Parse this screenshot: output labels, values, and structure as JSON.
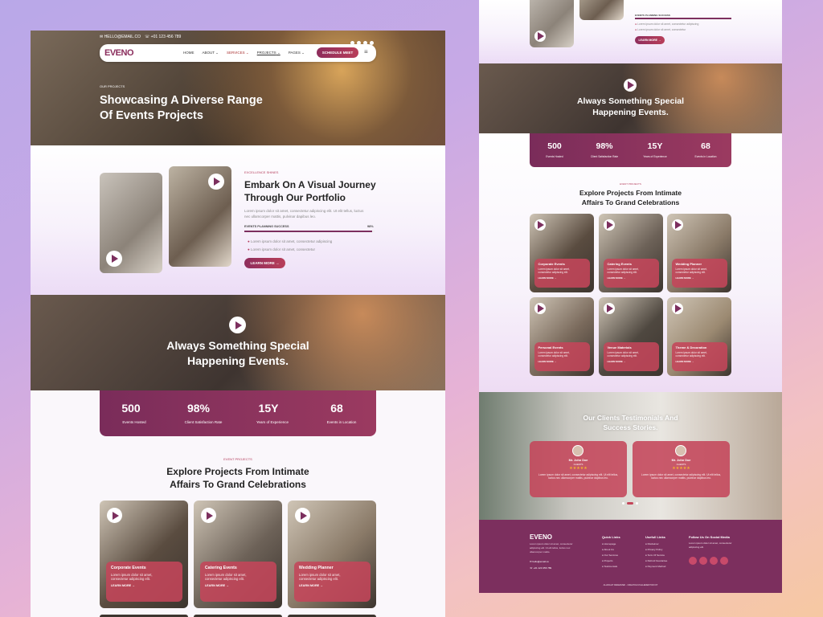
{
  "topbar": {
    "email": "HELLO@EMAIL.CO",
    "phone": "+01 123 456 789"
  },
  "nav": {
    "logo": "EVENO",
    "items": [
      "HOME",
      "ABOUT",
      "SERVICES",
      "PROJECTS",
      "PAGES"
    ],
    "cta": "SCHEDULE MEET"
  },
  "hero": {
    "eyebrow": "OUR PROJECTS",
    "title_line1": "Showcasing A Diverse Range",
    "title_line2": "Of Events Projects"
  },
  "portfolio": {
    "eyebrow": "EXCELLENCE SHINES",
    "title_line1": "Embark On A Visual Journey",
    "title_line2": "Through Our Portfolio",
    "body_line1": "Lorem ipsum dolor sit amet, consectetur adipiscing elit. Ut elit tellus, luctus",
    "body_line2": "nec ullamcorper mattis, pulvinar dapibus leo.",
    "bar_label": "EVENTS PLANNING SUCCESS",
    "bar_value": "98%",
    "bar_fraction": 0.98,
    "bullets": [
      "Lorem ipsum dolor sit amet, consectetur adipiscing",
      "Lorem ipsum dolor sit amet, consectetur"
    ],
    "button": "LEARN MORE"
  },
  "video": {
    "title_line1": "Always Something Special",
    "title_line2": "Happening Events."
  },
  "stats": [
    {
      "value": "500",
      "label": "Events Hosted"
    },
    {
      "value": "98%",
      "label": "Client Satisfaction Rate"
    },
    {
      "value": "15Y",
      "label": "Years of Experience"
    },
    {
      "value": "68",
      "label": "Events in Location"
    }
  ],
  "projects": {
    "eyebrow": "EVENT PROJECTS",
    "title_line1": "Explore Projects From Intimate",
    "title_line2": "Affairs To Grand Celebrations",
    "desc_line1": "Lorem ipsum dolor sit amet,",
    "desc_line2": "consectetur adipiscing elit.",
    "link": "LEARN MORE",
    "cards": [
      "Corporate Events",
      "Catering Events",
      "Wedding Planner",
      "Personal Events",
      "Venue Materials",
      "Theme & Decoration"
    ]
  },
  "testimonials": {
    "title_line1": "Our Clients Testimonials And",
    "title_line2": "Success Stories.",
    "items": [
      {
        "name": "Mr. John Doe",
        "role": "CLIENTS",
        "stars": "★★★★★"
      },
      {
        "name": "Mr. John Doe",
        "role": "CLIENTS",
        "stars": "★★★★★"
      }
    ],
    "quote": "Lorem ipsum dolor sit amet, consectetur adipiscing elit. Ut elit tellus, luctus nec ullamcorper mattis, pulvinar dapibus leo."
  },
  "footer": {
    "logo": "EVENO",
    "about": "Lorem ipsum dolor sit amet, consectetur adipiscing elit. Ut elit tellus, luctus nec ullamcorper mattis.",
    "email": "hello@email.co",
    "phone": "+01 123 456 789",
    "quick_title": "Quick Links",
    "quick": [
      "Homepage",
      "About Us",
      "Our Services",
      "Projects",
      "Testimonials"
    ],
    "useful_title": "Usefull Links",
    "useful": [
      "Disclaimer",
      "Privacy Policy",
      "Term Of Service",
      "Refund Guarantee",
      "Payment Method"
    ],
    "social_title": "Follow Us On Social Media",
    "social_text": "Lorem ipsum dolor sit amet, consectetur adipiscing elit.",
    "copyright": "ALLRIGHT RESERVED - CREATOLIUS ELEMENTOR KIT"
  },
  "colors": {
    "brand": "#7c2f5e",
    "accent": "#c4465a",
    "star": "#f2b233"
  }
}
